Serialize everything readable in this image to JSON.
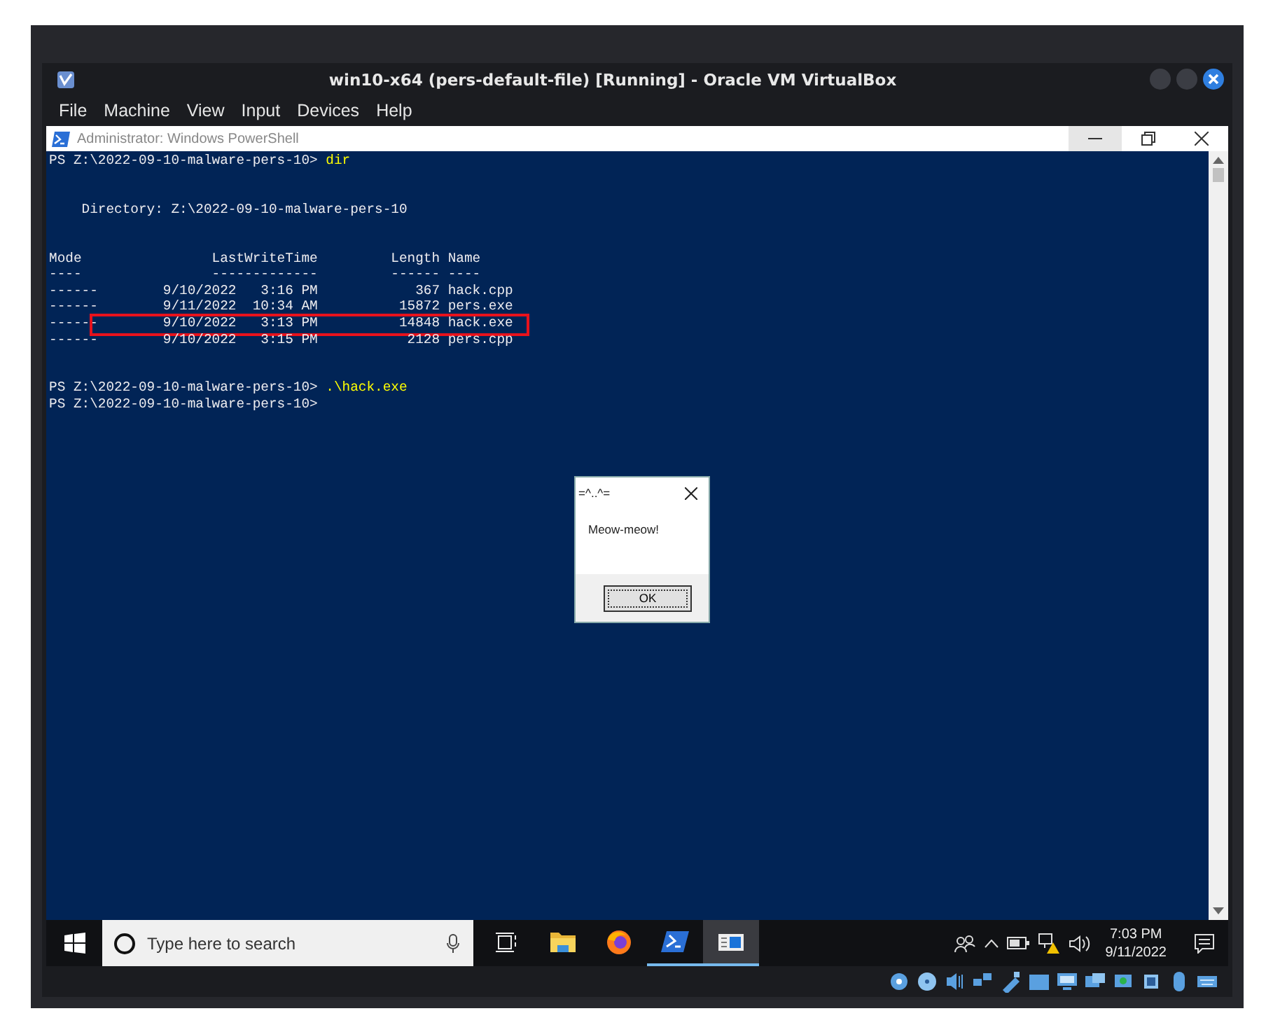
{
  "vbox": {
    "title": "win10-x64 (pers-default-file) [Running] - Oracle VM VirtualBox",
    "menu": [
      "File",
      "Machine",
      "View",
      "Input",
      "Devices",
      "Help"
    ]
  },
  "powershell": {
    "title": "Administrator: Windows PowerShell",
    "lines": [
      {
        "kind": "prompt",
        "prompt": "PS Z:\\2022-09-10-malware-pers-10> ",
        "command": "dir"
      },
      {
        "kind": "blank"
      },
      {
        "kind": "blank"
      },
      {
        "kind": "text",
        "text": "    Directory: Z:\\2022-09-10-malware-pers-10"
      },
      {
        "kind": "blank"
      },
      {
        "kind": "blank"
      },
      {
        "kind": "text",
        "text": "Mode                LastWriteTime         Length Name"
      },
      {
        "kind": "text",
        "text": "----                -------------         ------ ----"
      },
      {
        "kind": "row",
        "text": "------        9/10/2022   3:16 PM            367 hack.cpp",
        "highlighted": false
      },
      {
        "kind": "row",
        "text": "------        9/11/2022  10:34 AM          15872 pers.exe",
        "highlighted": false
      },
      {
        "kind": "row",
        "text": "------        9/10/2022   3:13 PM          14848 hack.exe",
        "highlighted": true
      },
      {
        "kind": "row",
        "text": "------        9/10/2022   3:15 PM           2128 pers.cpp",
        "highlighted": false
      },
      {
        "kind": "blank"
      },
      {
        "kind": "blank"
      },
      {
        "kind": "prompt",
        "prompt": "PS Z:\\2022-09-10-malware-pers-10> ",
        "command": ".\\hack.exe"
      },
      {
        "kind": "prompt",
        "prompt": "PS Z:\\2022-09-10-malware-pers-10>"
      }
    ]
  },
  "dialog": {
    "title": "=^..^=",
    "message": "Meow-meow!",
    "button": "OK"
  },
  "taskbar": {
    "search": {
      "placeholder": "Type here to search"
    },
    "apps": [
      {
        "kind": "taskview",
        "running": false,
        "selected": false
      },
      {
        "kind": "folder",
        "running": false,
        "selected": false
      },
      {
        "kind": "firefox",
        "running": false,
        "selected": false
      },
      {
        "kind": "powershell",
        "running": true,
        "selected": false
      },
      {
        "kind": "window",
        "running": true,
        "selected": true
      }
    ],
    "clock": {
      "time": "7:03 PM",
      "date": "9/11/2022"
    }
  }
}
